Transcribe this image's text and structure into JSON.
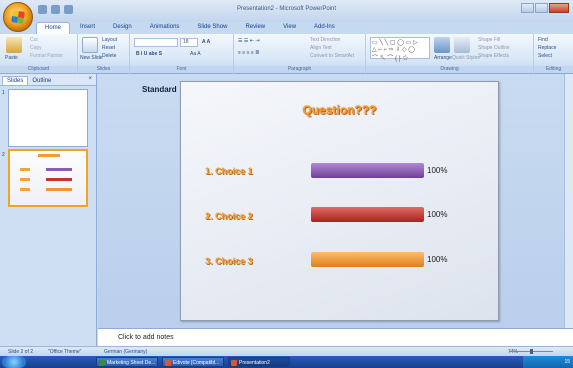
{
  "window": {
    "title": "Presentation2 - Microsoft PowerPoint"
  },
  "tabs": [
    "Home",
    "Insert",
    "Design",
    "Animations",
    "Slide Show",
    "Review",
    "View",
    "Add-Ins"
  ],
  "ribbon": {
    "clipboard": {
      "label": "Clipboard",
      "paste": "Paste",
      "cut": "Cut",
      "copy": "Copy",
      "format_painter": "Format Painter"
    },
    "slides": {
      "label": "Slides",
      "new_slide": "New Slide",
      "layout": "Layout",
      "reset": "Reset",
      "delete": "Delete"
    },
    "font": {
      "label": "Font",
      "size": "18"
    },
    "paragraph": {
      "label": "Paragraph",
      "text_direction": "Text Direction",
      "align_text": "Align Text",
      "convert_smartart": "Convert to SmartArt"
    },
    "drawing": {
      "label": "Drawing",
      "arrange": "Arrange",
      "quick_styles": "Quick Styles",
      "shape_fill": "Shape Fill",
      "shape_outline": "Shape Outline",
      "shape_effects": "Shape Effects"
    },
    "editing": {
      "label": "Editing",
      "find": "Find",
      "replace": "Replace",
      "select": "Select"
    }
  },
  "pane": {
    "tab_slides": "Slides",
    "tab_outline": "Outline",
    "close": "×",
    "thumb1_num": "1",
    "thumb2_num": "2"
  },
  "slide": {
    "layout_label": "Standard",
    "title": "Question???",
    "choices": [
      {
        "label": "1.  Choice 1",
        "pct": "100%",
        "color": "#8d5ab4"
      },
      {
        "label": "2.  Choice 2",
        "pct": "100%",
        "color": "#c2362f"
      },
      {
        "label": "3.  Choice 3",
        "pct": "100%",
        "color": "#f09633"
      }
    ]
  },
  "notes": {
    "placeholder": "Click to add notes"
  },
  "status": {
    "slide": "Slide 2 of 2",
    "theme": "\"Office Theme\"",
    "language": "German (Germany)",
    "zoom": "74%"
  },
  "taskbar": {
    "tasks": [
      "Marketing Sheet De...",
      "Edivote [Compatibl...",
      "Presentation2"
    ],
    "clock": "15"
  }
}
